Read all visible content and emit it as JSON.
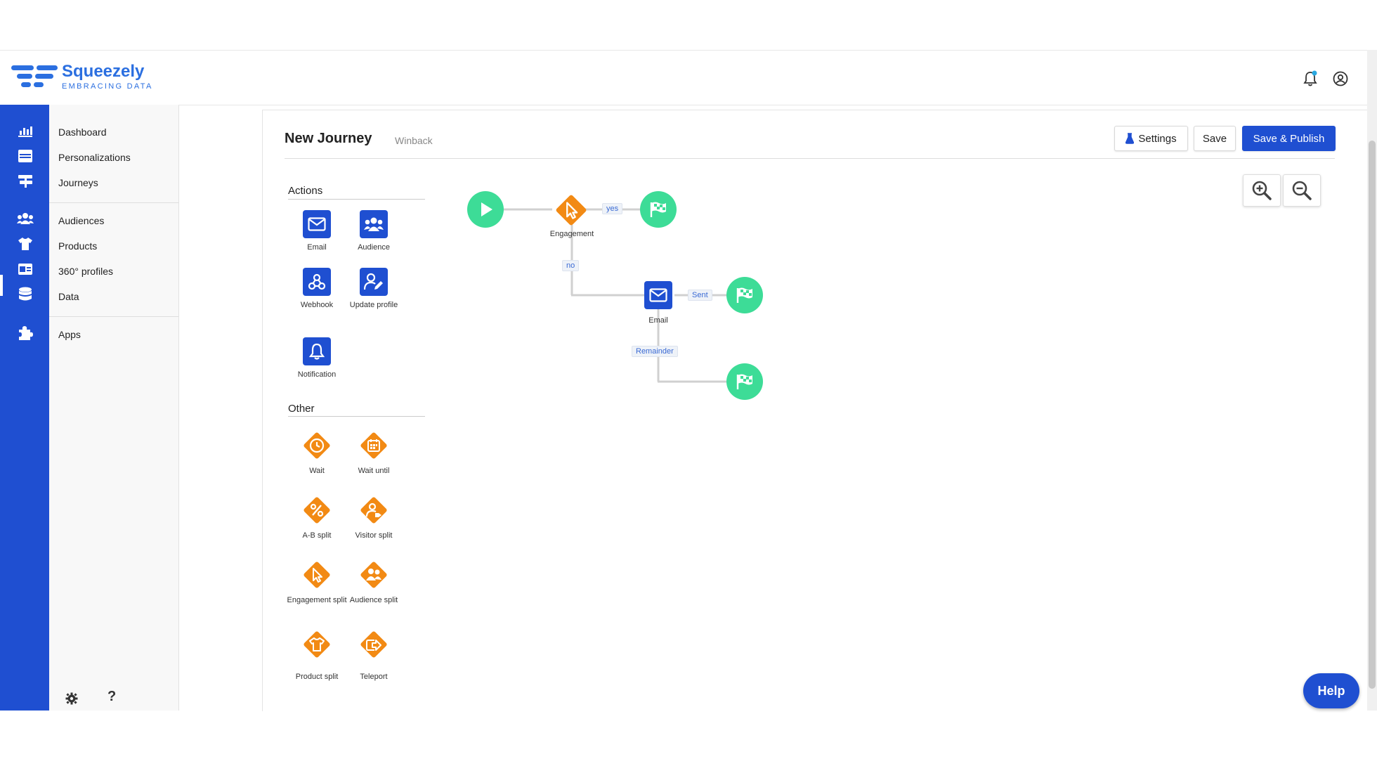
{
  "brand": {
    "name": "Squeezely",
    "tagline": "EMBRACING DATA",
    "color": "#2b6fe0"
  },
  "header": {
    "icons": [
      "bell-icon",
      "user-circle-icon"
    ]
  },
  "rail": {
    "icons": [
      "chart-icon",
      "personalization-icon",
      "journey-icon",
      "audience-icon",
      "shirt-icon",
      "profile-card-icon",
      "database-icon",
      "puzzle-icon"
    ]
  },
  "nav": {
    "items": [
      {
        "label": "Dashboard"
      },
      {
        "label": "Personalizations"
      },
      {
        "label": "Journeys"
      },
      {
        "label": "Audiences"
      },
      {
        "label": "Products"
      },
      {
        "label": "360° profiles"
      },
      {
        "label": "Data"
      },
      {
        "label": "Apps"
      }
    ],
    "footer_icons": [
      "gear-icon",
      "question-icon"
    ]
  },
  "page": {
    "title": "New Journey",
    "subtitle": "Winback",
    "settings_label": "Settings",
    "save_label": "Save",
    "publish_label": "Save & Publish"
  },
  "palette": {
    "actions_label": "Actions",
    "actions": [
      {
        "label": "Email"
      },
      {
        "label": "Audience"
      },
      {
        "label": "Webhook"
      },
      {
        "label": "Update profile"
      },
      {
        "label": "Notification"
      }
    ],
    "other_label": "Other",
    "other": [
      {
        "label": "Wait"
      },
      {
        "label": "Wait until"
      },
      {
        "label": "A-B split"
      },
      {
        "label": "Visitor split"
      },
      {
        "label": "Engagement split"
      },
      {
        "label": "Audience split"
      },
      {
        "label": "Product split"
      },
      {
        "label": "Teleport"
      }
    ]
  },
  "canvas": {
    "nodes": [
      {
        "label": "Engagement"
      },
      {
        "label": "Email"
      }
    ],
    "edge_labels": {
      "yes": "yes",
      "no": "no",
      "sent": "Sent",
      "reminder": "Remainder"
    }
  },
  "help_label": "Help",
  "colors": {
    "primary": "#1f4fd1",
    "orange": "#f28a14",
    "green": "#3ddc97"
  }
}
